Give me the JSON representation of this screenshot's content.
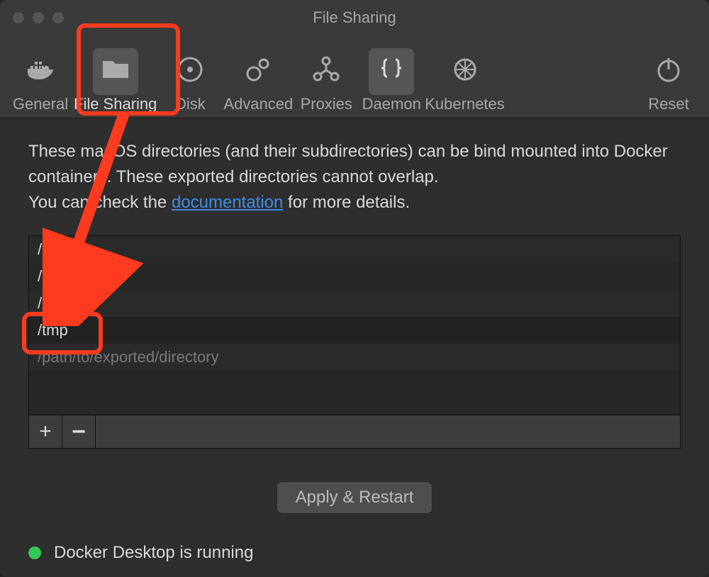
{
  "window": {
    "title": "File Sharing"
  },
  "tabs": {
    "general": {
      "label": "General"
    },
    "filesharing": {
      "label": "File Sharing"
    },
    "disk": {
      "label": "Disk"
    },
    "advanced": {
      "label": "Advanced"
    },
    "proxies": {
      "label": "Proxies"
    },
    "daemon": {
      "label": "Daemon"
    },
    "kubernetes": {
      "label": "Kubernetes"
    },
    "reset": {
      "label": "Reset"
    }
  },
  "desc": {
    "line1": "These macOS directories (and their subdirectories) can be bind mounted into Docker containers. These exported directories cannot overlap.",
    "line2a": "You can check the ",
    "link": "documentation",
    "line2b": " for more details."
  },
  "paths": {
    "items": [
      {
        "path": "/Users"
      },
      {
        "path": "/Volumes"
      },
      {
        "path": "/private"
      },
      {
        "path": "/tmp"
      },
      {
        "path": "/path/to/exported/directory",
        "placeholder": true
      }
    ]
  },
  "buttons": {
    "add": "+",
    "remove": "−",
    "apply": "Apply & Restart"
  },
  "status": {
    "text": "Docker Desktop is running",
    "color": "#34c857"
  },
  "annotations": {
    "highlight_tab": "filesharing",
    "highlight_path": "/tmp",
    "arrow_from": "filesharing-tab",
    "arrow_to": "/tmp-row"
  }
}
